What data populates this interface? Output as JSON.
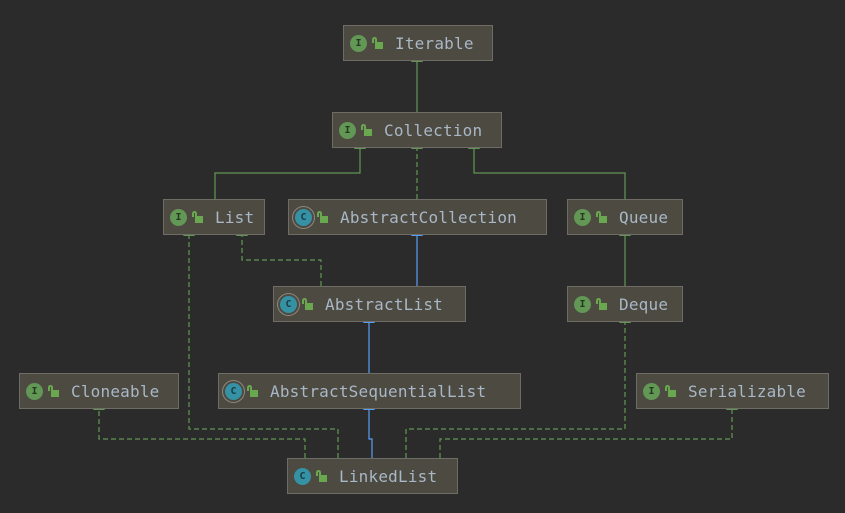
{
  "diagram": {
    "type": "uml-class-hierarchy",
    "colors": {
      "background": "#2b2b2b",
      "node_fill": "#4c4a41",
      "node_border": "#6e6c64",
      "label_text": "#a9b7c6",
      "interface_badge": "#629755",
      "class_badge": "#3592a5",
      "implements_edge": "#629755",
      "extends_class_edge": "#589df6"
    },
    "nodes": [
      {
        "id": "iterable",
        "label": "Iterable",
        "kind": "interface",
        "badge": "I"
      },
      {
        "id": "collection",
        "label": "Collection",
        "kind": "interface",
        "badge": "I"
      },
      {
        "id": "list",
        "label": "List",
        "kind": "interface",
        "badge": "I"
      },
      {
        "id": "abstract-collection",
        "label": "AbstractCollection",
        "kind": "abstract-class",
        "badge": "C"
      },
      {
        "id": "queue",
        "label": "Queue",
        "kind": "interface",
        "badge": "I"
      },
      {
        "id": "abstract-list",
        "label": "AbstractList",
        "kind": "abstract-class",
        "badge": "C"
      },
      {
        "id": "deque",
        "label": "Deque",
        "kind": "interface",
        "badge": "I"
      },
      {
        "id": "cloneable",
        "label": "Cloneable",
        "kind": "interface",
        "badge": "I"
      },
      {
        "id": "abstract-sequential-list",
        "label": "AbstractSequentialList",
        "kind": "abstract-class",
        "badge": "C"
      },
      {
        "id": "serializable",
        "label": "Serializable",
        "kind": "interface",
        "badge": "I"
      },
      {
        "id": "linked-list",
        "label": "LinkedList",
        "kind": "class",
        "badge": "C"
      }
    ],
    "edges": [
      {
        "from": "collection",
        "to": "iterable",
        "relation": "extends-interface",
        "style": "solid-green"
      },
      {
        "from": "list",
        "to": "collection",
        "relation": "extends-interface",
        "style": "solid-green"
      },
      {
        "from": "abstract-collection",
        "to": "collection",
        "relation": "implements",
        "style": "dashed-green"
      },
      {
        "from": "queue",
        "to": "collection",
        "relation": "extends-interface",
        "style": "solid-green"
      },
      {
        "from": "abstract-list",
        "to": "abstract-collection",
        "relation": "extends",
        "style": "solid-blue"
      },
      {
        "from": "abstract-list",
        "to": "list",
        "relation": "implements",
        "style": "dashed-green"
      },
      {
        "from": "deque",
        "to": "queue",
        "relation": "extends-interface",
        "style": "solid-green"
      },
      {
        "from": "abstract-sequential-list",
        "to": "abstract-list",
        "relation": "extends",
        "style": "solid-blue"
      },
      {
        "from": "linked-list",
        "to": "abstract-sequential-list",
        "relation": "extends",
        "style": "solid-blue"
      },
      {
        "from": "linked-list",
        "to": "list",
        "relation": "implements",
        "style": "dashed-green"
      },
      {
        "from": "linked-list",
        "to": "cloneable",
        "relation": "implements",
        "style": "dashed-green"
      },
      {
        "from": "linked-list",
        "to": "deque",
        "relation": "implements",
        "style": "dashed-green"
      },
      {
        "from": "linked-list",
        "to": "serializable",
        "relation": "implements",
        "style": "dashed-green"
      }
    ]
  }
}
